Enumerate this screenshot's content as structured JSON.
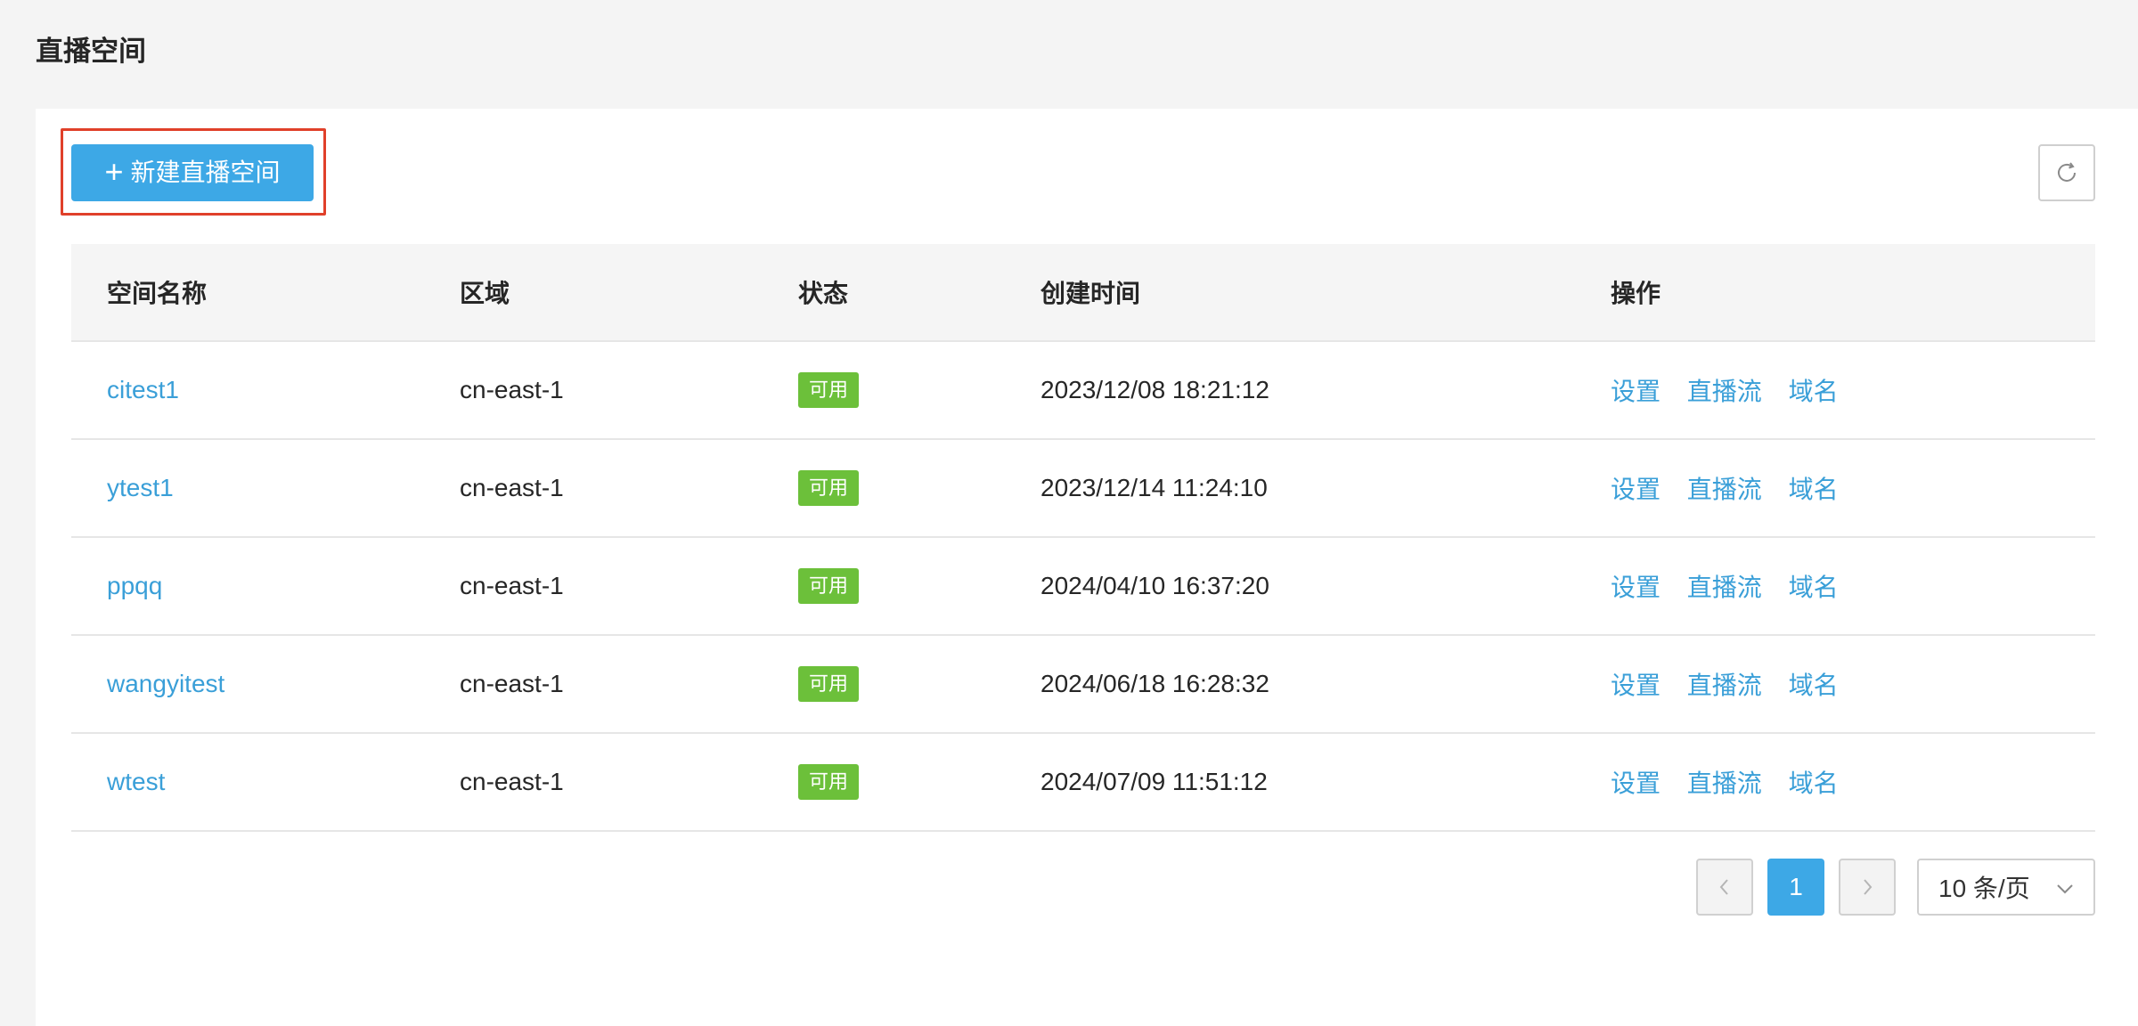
{
  "page": {
    "title": "直播空间"
  },
  "toolbar": {
    "new_label": "新建直播空间",
    "new_icon": "plus-icon",
    "refresh_icon": "refresh-icon"
  },
  "table": {
    "headers": [
      "空间名称",
      "区域",
      "状态",
      "创建时间",
      "操作"
    ],
    "rows": [
      {
        "name": "citest1",
        "region": "cn-east-1",
        "status": "可用",
        "created": "2023/12/08 18:21:12"
      },
      {
        "name": "ytest1",
        "region": "cn-east-1",
        "status": "可用",
        "created": "2023/12/14 11:24:10"
      },
      {
        "name": "ppqq",
        "region": "cn-east-1",
        "status": "可用",
        "created": "2024/04/10 16:37:20"
      },
      {
        "name": "wangyitest",
        "region": "cn-east-1",
        "status": "可用",
        "created": "2024/06/18 16:28:32"
      },
      {
        "name": "wtest",
        "region": "cn-east-1",
        "status": "可用",
        "created": "2024/07/09 11:51:12"
      }
    ],
    "actions": [
      "设置",
      "直播流",
      "域名"
    ]
  },
  "pagination": {
    "current_page": "1",
    "page_size": "10 条/页"
  },
  "colors": {
    "primary": "#3da8e6",
    "link": "#3a9fd8",
    "status_ok": "#6cc03a",
    "highlight": "#e0402a"
  }
}
